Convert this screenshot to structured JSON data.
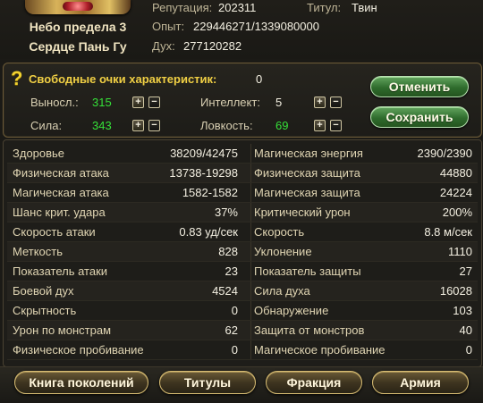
{
  "header": {
    "name_line1": "Небо предела 3",
    "name_line2": "Сердце Пань Гу",
    "reputation_label": "Репутация:",
    "reputation_value": "202311",
    "title_label": "Титул:",
    "title_value": "Твин",
    "exp_label": "Опыт:",
    "exp_value": "229446271/1339080000",
    "spirit_label": "Дух:",
    "spirit_value": "277120282"
  },
  "points": {
    "title": "Свободные очки характеристик:",
    "free_value": "0",
    "endurance_label": "Выносл.:",
    "endurance_value": "315",
    "intellect_label": "Интеллект:",
    "intellect_value": "5",
    "strength_label": "Сила:",
    "strength_value": "343",
    "agility_label": "Ловкость:",
    "agility_value": "69",
    "plus_glyph": "+",
    "minus_glyph": "−",
    "cancel_label": "Отменить",
    "save_label": "Сохранить"
  },
  "stats": [
    {
      "left_label": "Здоровье",
      "left_value": "38209/42475",
      "right_label": "Магическая энергия",
      "right_value": "2390/2390"
    },
    {
      "left_label": "Физическая атака",
      "left_value": "13738-19298",
      "right_label": "Физическая защита",
      "right_value": "44880"
    },
    {
      "left_label": "Магическая атака",
      "left_value": "1582-1582",
      "right_label": "Магическая защита",
      "right_value": "24224"
    },
    {
      "left_label": "Шанс крит. удара",
      "left_value": "37%",
      "right_label": "Критический урон",
      "right_value": "200%"
    },
    {
      "left_label": "Скорость атаки",
      "left_value": "0.83 уд/сек",
      "right_label": "Скорость",
      "right_value": "8.8 м/сек"
    },
    {
      "left_label": "Меткость",
      "left_value": "828",
      "right_label": "Уклонение",
      "right_value": "1110"
    },
    {
      "left_label": "Показатель атаки",
      "left_value": "23",
      "right_label": "Показатель защиты",
      "right_value": "27"
    },
    {
      "left_label": "Боевой дух",
      "left_value": "4524",
      "right_label": "Сила духа",
      "right_value": "16028"
    },
    {
      "left_label": "Скрытность",
      "left_value": "0",
      "right_label": "Обнаружение",
      "right_value": "103"
    },
    {
      "left_label": "Урон по монстрам",
      "left_value": "62",
      "right_label": "Защита от монстров",
      "right_value": "40"
    },
    {
      "left_label": "Физическое пробивание",
      "left_value": "0",
      "right_label": "Магическое пробивание",
      "right_value": "0"
    }
  ],
  "bottom": {
    "generations_label": "Книга поколений",
    "titles_label": "Титулы",
    "faction_label": "Фракция",
    "army_label": "Армия"
  },
  "icons": {
    "help": "question-mark-icon",
    "plus": "plus-icon",
    "minus": "minus-icon"
  },
  "colors": {
    "stat_green": "#35e038",
    "title_gold": "#f0cf44",
    "button_green": "#2f6c2d"
  }
}
